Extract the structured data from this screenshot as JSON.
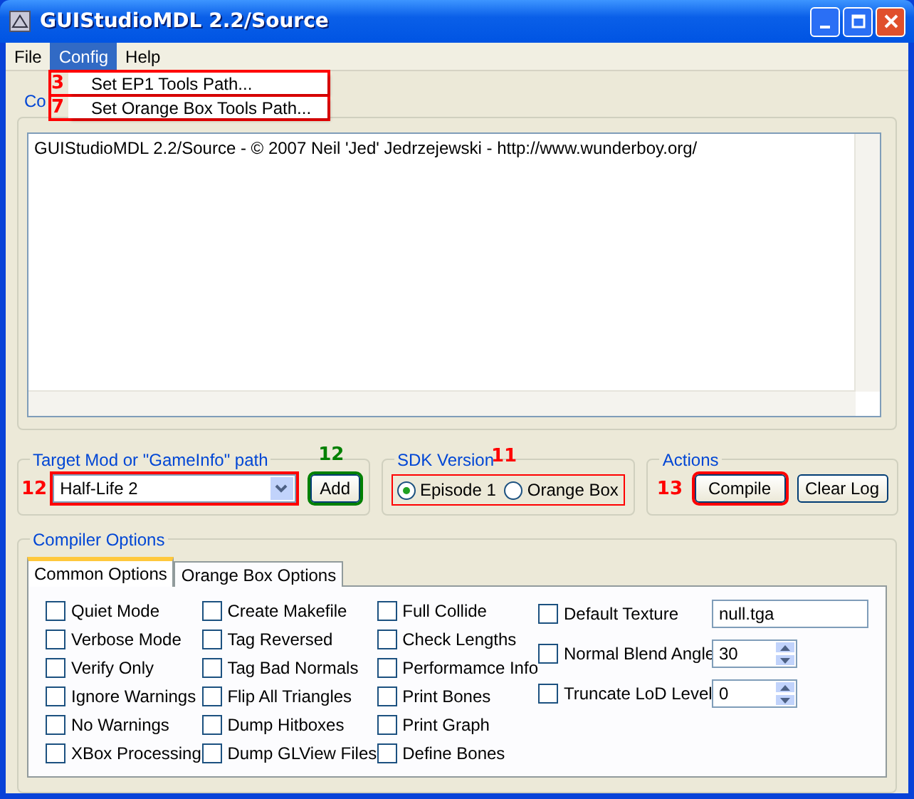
{
  "window": {
    "title": "GUIStudioMDL 2.2/Source"
  },
  "menu_bar": [
    {
      "label": "File",
      "selected": false
    },
    {
      "label": "Config",
      "selected": true
    },
    {
      "label": "Help",
      "selected": false
    }
  ],
  "open_menu": {
    "items": [
      {
        "label": "Set EP1 Tools Path...",
        "marker": {
          "label": "3",
          "color": "#ff0000"
        }
      },
      {
        "label": "Set Orange Box Tools Path...",
        "marker": {
          "label": "7",
          "color": "#ff0000"
        }
      }
    ]
  },
  "console": {
    "title": "Co",
    "log": "GUIStudioMDL 2.2/Source - © 2007 Neil 'Jed' Jedrzejewski - http://www.wunderboy.org/"
  },
  "target": {
    "title": "Target Mod or \"GameInfo\" path",
    "value": "Half-Life 2",
    "marker": {
      "label": "12",
      "color": "#ff0000"
    },
    "add_button": {
      "label": "Add",
      "marker": {
        "label": "12",
        "color": "#008000"
      }
    }
  },
  "sdk_version": {
    "title": "SDK Version",
    "marker": {
      "label": "11",
      "color": "#ff0000"
    },
    "options": [
      {
        "label": "Episode 1",
        "selected": true
      },
      {
        "label": "Orange Box",
        "selected": false
      }
    ]
  },
  "actions": {
    "title": "Actions",
    "buttons": [
      {
        "label": "Compile",
        "marker": {
          "label": "13",
          "color": "#ff0000"
        }
      },
      {
        "label": "Clear Log"
      }
    ]
  },
  "compiler_options": {
    "title": "Compiler Options",
    "tabs": [
      {
        "label": "Common Options",
        "selected": true
      },
      {
        "label": "Orange Box Options",
        "selected": false
      }
    ],
    "columns": [
      [
        {
          "label": "Quiet Mode",
          "checked": false
        },
        {
          "label": "Verbose Mode",
          "checked": false
        },
        {
          "label": "Verify Only",
          "checked": false
        },
        {
          "label": "Ignore Warnings",
          "checked": false
        },
        {
          "label": "No Warnings",
          "checked": false
        },
        {
          "label": "XBox Processing",
          "checked": false
        }
      ],
      [
        {
          "label": "Create Makefile",
          "checked": false
        },
        {
          "label": "Tag Reversed",
          "checked": false
        },
        {
          "label": "Tag Bad Normals",
          "checked": false
        },
        {
          "label": "Flip All Triangles",
          "checked": false
        },
        {
          "label": "Dump Hitboxes",
          "checked": false
        },
        {
          "label": "Dump GLView Files",
          "checked": false
        }
      ],
      [
        {
          "label": "Full Collide",
          "checked": false
        },
        {
          "label": "Check Lengths",
          "checked": false
        },
        {
          "label": "Performamce Info",
          "checked": false
        },
        {
          "label": "Print Bones",
          "checked": false
        },
        {
          "label": "Print Graph",
          "checked": false
        },
        {
          "label": "Define Bones",
          "checked": false
        }
      ]
    ],
    "value_options": [
      {
        "kind": "text",
        "label": "Default Texture",
        "checked": false,
        "value": "null.tga"
      },
      {
        "kind": "spinner",
        "label": "Normal Blend Angle",
        "checked": false,
        "value": "30"
      },
      {
        "kind": "spinner",
        "label": "Truncate LoD Level",
        "checked": false,
        "value": "0"
      }
    ]
  }
}
